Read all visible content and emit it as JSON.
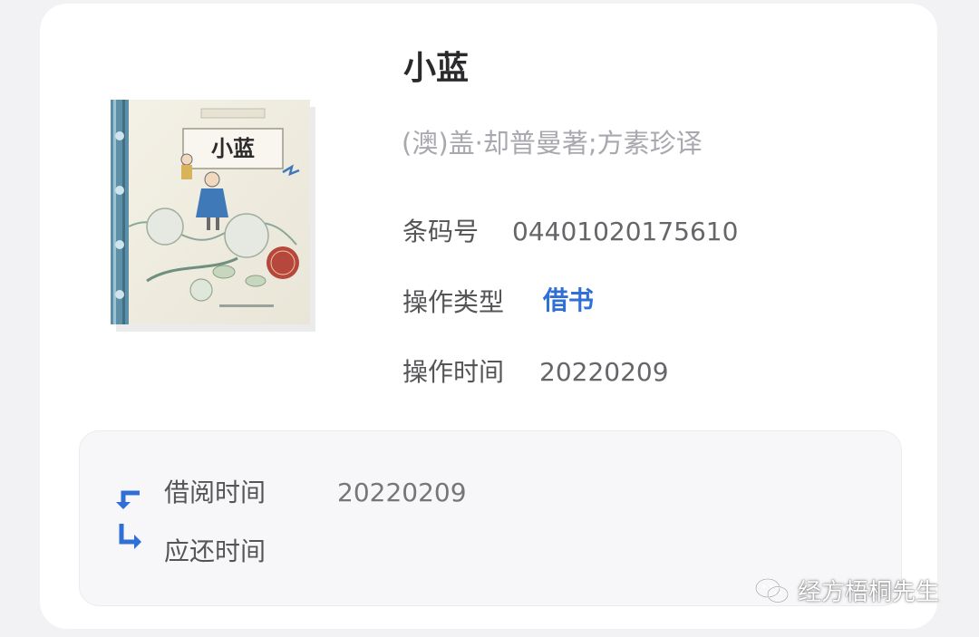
{
  "book": {
    "cover_title": "小蓝",
    "title": "小蓝",
    "author": "(澳)盖·却普曼著;方素珍译"
  },
  "fields": {
    "barcode_label": "条码号",
    "barcode_value": "04401020175610",
    "operation_type_label": "操作类型",
    "operation_type_value": "借书",
    "operation_time_label": "操作时间",
    "operation_time_value": "20220209"
  },
  "borrow": {
    "borrow_time_label": "借阅时间",
    "borrow_time_value": "20220209",
    "return_time_label": "应还时间",
    "return_time_value": ""
  },
  "watermark": {
    "text": "经方梧桐先生",
    "icon": "wechat-icon"
  },
  "colors": {
    "accent": "#2f6fd6",
    "background": "#f2f2f5",
    "card": "#ffffff"
  }
}
